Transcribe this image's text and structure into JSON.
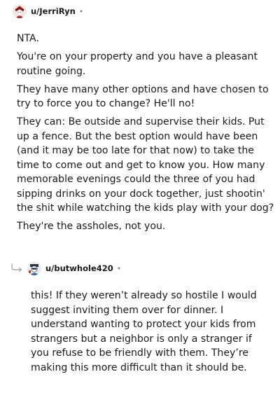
{
  "comments": [
    {
      "username": "u/JerriRyn",
      "separator": "•",
      "avatar": "snoo-avatar-icon",
      "paragraphs": [
        "NTA.",
        "You're on your property and you have a pleasant routine going.",
        "They have many other options and have chosen to try to force you to change? He'll no!",
        "They can: Be outside and supervise their kids. Put up a fence. But the best option would have been (and it may be too late for that now) to take the time to come out and get to know you. How many memorable evenings could the three of you had sipping drinks on your dock together, just shootin' the shit while watching the kids play with your dog?",
        "They're the assholes, not you."
      ]
    },
    {
      "username": "u/butwhole420",
      "separator": "•",
      "avatar": "snoo-avatar-icon",
      "reply_icon": "reply-arrow-icon",
      "paragraphs": [
        "this! If they weren’t already so hostile I would suggest inviting them over for dinner. I understand wanting to protect your kids from strangers but a neighbor is only a stranger if you refuse to be friendly with them. They’re making this more difficult than it should be."
      ]
    }
  ]
}
